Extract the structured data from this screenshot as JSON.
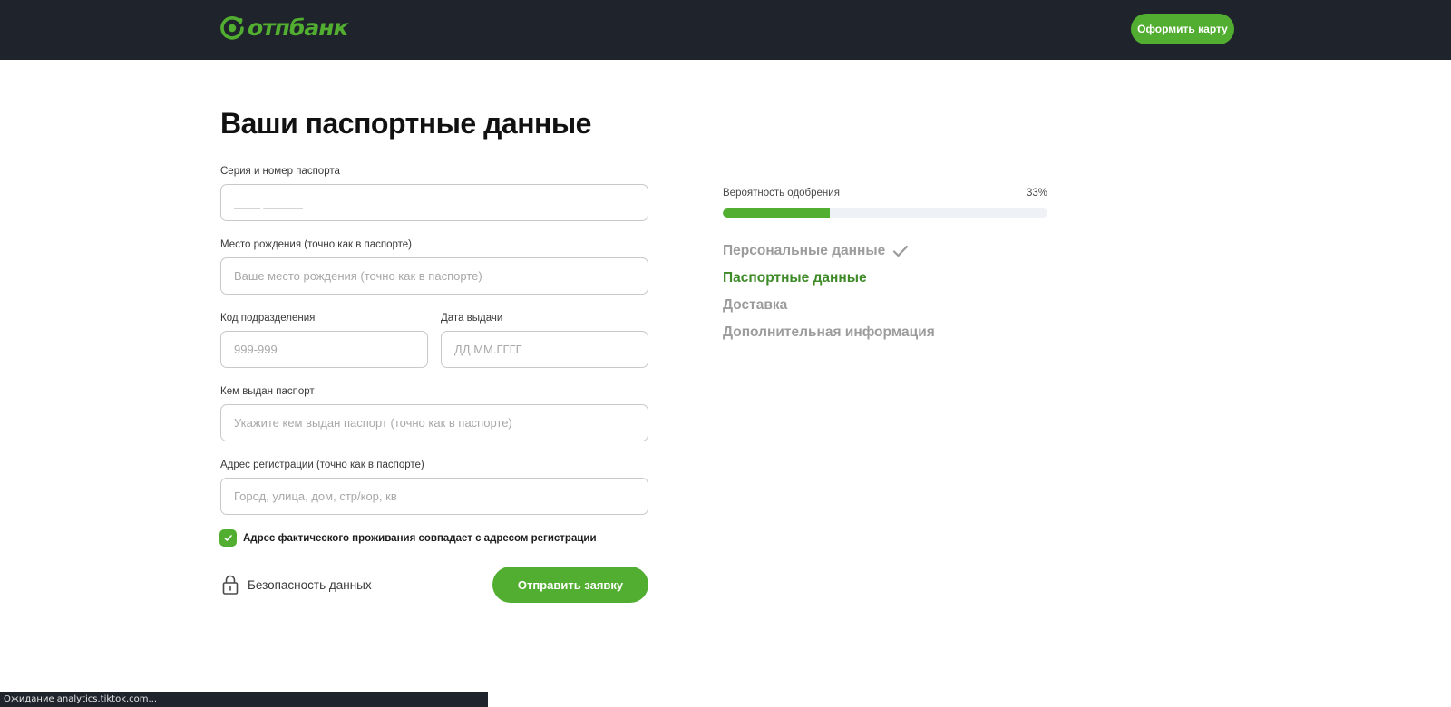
{
  "header": {
    "logo_text": "отпбанк",
    "cta_label": "Оформить карту"
  },
  "form": {
    "title": "Ваши паспортные данные",
    "fields": [
      {
        "label": "Серия и номер паспорта",
        "value": "",
        "placeholder": "____ ______"
      },
      {
        "label": "Место рождения (точно как в паспорте)",
        "value": "",
        "placeholder": "Ваше место рождения (точно как в паспорте)"
      },
      {
        "label": "Код подразделения",
        "value": "",
        "placeholder": "999-999"
      },
      {
        "label": "Дата выдачи",
        "value": "",
        "placeholder": "ДД.ММ.ГГГГ"
      },
      {
        "label": "Кем выдан паспорт",
        "value": "",
        "placeholder": "Укажите кем выдан паспорт (точно как в паспорте)"
      },
      {
        "label": "Адрес регистрации (точно как в паспорте)",
        "value": "",
        "placeholder": "Город, улица, дом, стр/кор, кв"
      }
    ],
    "checkbox": {
      "label": "Адрес фактического проживания совпадает с адресом регистрации",
      "checked": true
    },
    "security_label": "Безопасность данных",
    "submit_label": "Отправить заявку"
  },
  "progress": {
    "label": "Вероятность одобрения",
    "value_text": "33%",
    "value": 0.33,
    "steps": [
      {
        "label": "Персональные данные",
        "state": "done"
      },
      {
        "label": "Паспортные данные",
        "state": "active"
      },
      {
        "label": "Доставка",
        "state": "pending"
      },
      {
        "label": "Дополнительная информация",
        "state": "pending"
      }
    ]
  },
  "status_bar": {
    "text": "Ожидание analytics.tiktok.com..."
  },
  "colors": {
    "brand_green": "#52ae30",
    "active_step": "#3d8a26",
    "header_bg": "#1f232b"
  },
  "icons": {
    "logo": "otp-logo-icon",
    "check": "check-icon",
    "lock": "lock-icon"
  }
}
